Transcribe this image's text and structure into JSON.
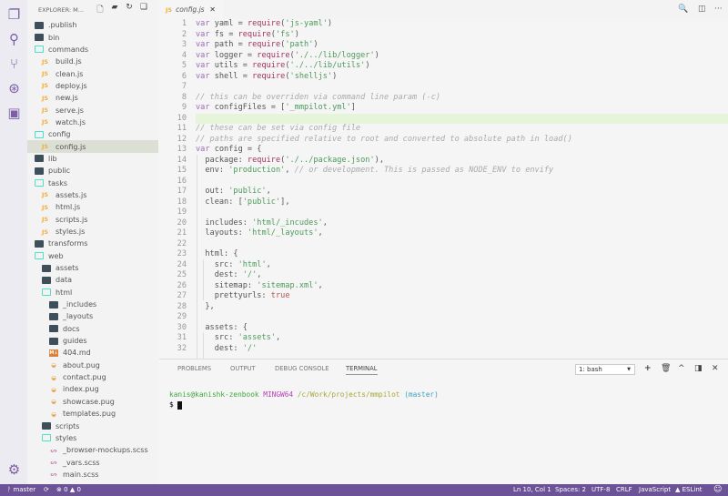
{
  "activity_bar": [
    {
      "icon": "files-icon",
      "glyph": "❐"
    },
    {
      "icon": "search-icon",
      "glyph": "⚲"
    },
    {
      "icon": "source-control-icon",
      "glyph": "⑂"
    },
    {
      "icon": "debug-icon",
      "glyph": "⊛"
    },
    {
      "icon": "extensions-icon",
      "glyph": "▣"
    }
  ],
  "settings_icon": "⚙",
  "explorer": {
    "title": "EXPLORER: M...",
    "actions": [
      {
        "name": "new-file",
        "glyph": "🗋"
      },
      {
        "name": "new-folder",
        "glyph": "▰"
      },
      {
        "name": "refresh",
        "glyph": "↻"
      },
      {
        "name": "collapse-all",
        "glyph": "❏"
      }
    ],
    "tree": [
      {
        "name": ".publish",
        "depth": 0,
        "type": "fc"
      },
      {
        "name": "bin",
        "depth": 0,
        "type": "fc"
      },
      {
        "name": "commands",
        "depth": 0,
        "type": "fo"
      },
      {
        "name": "build.js",
        "depth": 1,
        "type": "js"
      },
      {
        "name": "clean.js",
        "depth": 1,
        "type": "js"
      },
      {
        "name": "deploy.js",
        "depth": 1,
        "type": "js"
      },
      {
        "name": "new.js",
        "depth": 1,
        "type": "js"
      },
      {
        "name": "serve.js",
        "depth": 1,
        "type": "js"
      },
      {
        "name": "watch.js",
        "depth": 1,
        "type": "js"
      },
      {
        "name": "config",
        "depth": 0,
        "type": "fo"
      },
      {
        "name": "config.js",
        "depth": 1,
        "type": "js",
        "selected": true
      },
      {
        "name": "lib",
        "depth": 0,
        "type": "fc"
      },
      {
        "name": "public",
        "depth": 0,
        "type": "fc"
      },
      {
        "name": "tasks",
        "depth": 0,
        "type": "fo"
      },
      {
        "name": "assets.js",
        "depth": 1,
        "type": "js"
      },
      {
        "name": "html.js",
        "depth": 1,
        "type": "js"
      },
      {
        "name": "scripts.js",
        "depth": 1,
        "type": "js"
      },
      {
        "name": "styles.js",
        "depth": 1,
        "type": "js"
      },
      {
        "name": "transforms",
        "depth": 0,
        "type": "fc"
      },
      {
        "name": "web",
        "depth": 0,
        "type": "fo"
      },
      {
        "name": "assets",
        "depth": 1,
        "type": "fc"
      },
      {
        "name": "data",
        "depth": 1,
        "type": "fc"
      },
      {
        "name": "html",
        "depth": 1,
        "type": "fo"
      },
      {
        "name": "_includes",
        "depth": 2,
        "type": "fc"
      },
      {
        "name": "_layouts",
        "depth": 2,
        "type": "fc"
      },
      {
        "name": "docs",
        "depth": 2,
        "type": "fc"
      },
      {
        "name": "guides",
        "depth": 2,
        "type": "fc"
      },
      {
        "name": "404.md",
        "depth": 2,
        "type": "md"
      },
      {
        "name": "about.pug",
        "depth": 2,
        "type": "pug"
      },
      {
        "name": "contact.pug",
        "depth": 2,
        "type": "pug"
      },
      {
        "name": "index.pug",
        "depth": 2,
        "type": "pug"
      },
      {
        "name": "showcase.pug",
        "depth": 2,
        "type": "pug"
      },
      {
        "name": "templates.pug",
        "depth": 2,
        "type": "pug"
      },
      {
        "name": "scripts",
        "depth": 1,
        "type": "fc"
      },
      {
        "name": "styles",
        "depth": 1,
        "type": "fo"
      },
      {
        "name": "_browser-mockups.scss",
        "depth": 2,
        "type": "scss"
      },
      {
        "name": "_vars.scss",
        "depth": 2,
        "type": "scss"
      },
      {
        "name": "main.scss",
        "depth": 2,
        "type": "scss"
      }
    ]
  },
  "editor": {
    "tab": {
      "lang": "JS",
      "name": "config.js",
      "close": "✕"
    },
    "toolbar": [
      {
        "name": "open-preview",
        "glyph": "🔍"
      },
      {
        "name": "split-editor",
        "glyph": "◫"
      },
      {
        "name": "more",
        "glyph": "···"
      }
    ],
    "current_line": 10,
    "lines": [
      [
        [
          "k",
          "var"
        ],
        [
          "p",
          " yaml = "
        ],
        [
          "f",
          "require"
        ],
        [
          "p",
          "("
        ],
        [
          "s",
          "'js-yaml'"
        ],
        [
          "p",
          ")"
        ]
      ],
      [
        [
          "k",
          "var"
        ],
        [
          "p",
          " fs = "
        ],
        [
          "f",
          "require"
        ],
        [
          "p",
          "("
        ],
        [
          "s",
          "'fs'"
        ],
        [
          "p",
          ")"
        ]
      ],
      [
        [
          "k",
          "var"
        ],
        [
          "p",
          " path = "
        ],
        [
          "f",
          "require"
        ],
        [
          "p",
          "("
        ],
        [
          "s",
          "'path'"
        ],
        [
          "p",
          ")"
        ]
      ],
      [
        [
          "k",
          "var"
        ],
        [
          "p",
          " logger = "
        ],
        [
          "f",
          "require"
        ],
        [
          "p",
          "("
        ],
        [
          "s",
          "'./../lib/logger'"
        ],
        [
          "p",
          ")"
        ]
      ],
      [
        [
          "k",
          "var"
        ],
        [
          "p",
          " utils = "
        ],
        [
          "f",
          "require"
        ],
        [
          "p",
          "("
        ],
        [
          "s",
          "'./../lib/utils'"
        ],
        [
          "p",
          ")"
        ]
      ],
      [
        [
          "k",
          "var"
        ],
        [
          "p",
          " shell = "
        ],
        [
          "f",
          "require"
        ],
        [
          "p",
          "("
        ],
        [
          "s",
          "'shelljs'"
        ],
        [
          "p",
          ")"
        ]
      ],
      [],
      [
        [
          "c",
          "// this can be overriden via command line param (-c)"
        ]
      ],
      [
        [
          "k",
          "var"
        ],
        [
          "p",
          " configFiles = ["
        ],
        [
          "s",
          "'_mmpilot.yml'"
        ],
        [
          "p",
          "]"
        ]
      ],
      [],
      [
        [
          "c",
          "// these can be set via config file"
        ]
      ],
      [
        [
          "c",
          "// paths are specified relative to root and converted to absolute path in load()"
        ]
      ],
      [
        [
          "k",
          "var"
        ],
        [
          "p",
          " config = {"
        ]
      ],
      [
        [
          "p",
          "  package: "
        ],
        [
          "f",
          "require"
        ],
        [
          "p",
          "("
        ],
        [
          "s",
          "'./../package.json'"
        ],
        [
          "p",
          "),"
        ]
      ],
      [
        [
          "p",
          "  env: "
        ],
        [
          "s",
          "'production'"
        ],
        [
          "p",
          ", "
        ],
        [
          "c",
          "// or development. This is passed as NODE_ENV to envify"
        ]
      ],
      [],
      [
        [
          "p",
          "  out: "
        ],
        [
          "s",
          "'public'"
        ],
        [
          "p",
          ","
        ]
      ],
      [
        [
          "p",
          "  clean: ["
        ],
        [
          "s",
          "'public'"
        ],
        [
          "p",
          "],"
        ]
      ],
      [],
      [
        [
          "p",
          "  includes: "
        ],
        [
          "s",
          "'html/_incudes'"
        ],
        [
          "p",
          ","
        ]
      ],
      [
        [
          "p",
          "  layouts: "
        ],
        [
          "s",
          "'html/_layouts'"
        ],
        [
          "p",
          ","
        ]
      ],
      [],
      [
        [
          "p",
          "  html: {"
        ]
      ],
      [
        [
          "p",
          "    src: "
        ],
        [
          "s",
          "'html'"
        ],
        [
          "p",
          ","
        ]
      ],
      [
        [
          "p",
          "    dest: "
        ],
        [
          "s",
          "'/'"
        ],
        [
          "p",
          ","
        ]
      ],
      [
        [
          "p",
          "    sitemap: "
        ],
        [
          "s",
          "'sitemap.xml'"
        ],
        [
          "p",
          ","
        ]
      ],
      [
        [
          "p",
          "    prettyurls: "
        ],
        [
          "b",
          "true"
        ]
      ],
      [
        [
          "p",
          "  },"
        ]
      ],
      [],
      [
        [
          "p",
          "  assets: {"
        ]
      ],
      [
        [
          "p",
          "    src: "
        ],
        [
          "s",
          "'assets'"
        ],
        [
          "p",
          ","
        ]
      ],
      [
        [
          "p",
          "    dest: "
        ],
        [
          "s",
          "'/'"
        ]
      ]
    ]
  },
  "panel": {
    "tabs": [
      "PROBLEMS",
      "OUTPUT",
      "DEBUG CONSOLE",
      "TERMINAL"
    ],
    "active_tab": "TERMINAL",
    "terminal_select": "1: bash",
    "actions": [
      {
        "name": "new-terminal",
        "glyph": "+"
      },
      {
        "name": "kill-terminal",
        "glyph": "🗑"
      },
      {
        "name": "maximize",
        "glyph": "^"
      },
      {
        "name": "toggle-panel",
        "glyph": "◨"
      },
      {
        "name": "close",
        "glyph": "✕"
      }
    ],
    "prompt": {
      "user": "kanis@kanishk-zenbook",
      "env": "MINGW64",
      "path": "/c/Work/projects/mmpilot",
      "branch": "(master)",
      "symbol": "$"
    }
  },
  "status": {
    "branch": "master",
    "sync": "⟳",
    "errors": "0",
    "warnings": "0",
    "position": "Ln 10, Col 1",
    "spaces": "Spaces: 2",
    "encoding": "UTF-8",
    "eol": "CRLF",
    "language": "JavaScript",
    "linter": "ESLint",
    "feedback": "☺"
  },
  "colors": {
    "status_bar": "#6c5296",
    "activity_icons": "#7b5ea7",
    "current_line": "#e6f4d9",
    "selected_row": "#dcdfd4"
  }
}
